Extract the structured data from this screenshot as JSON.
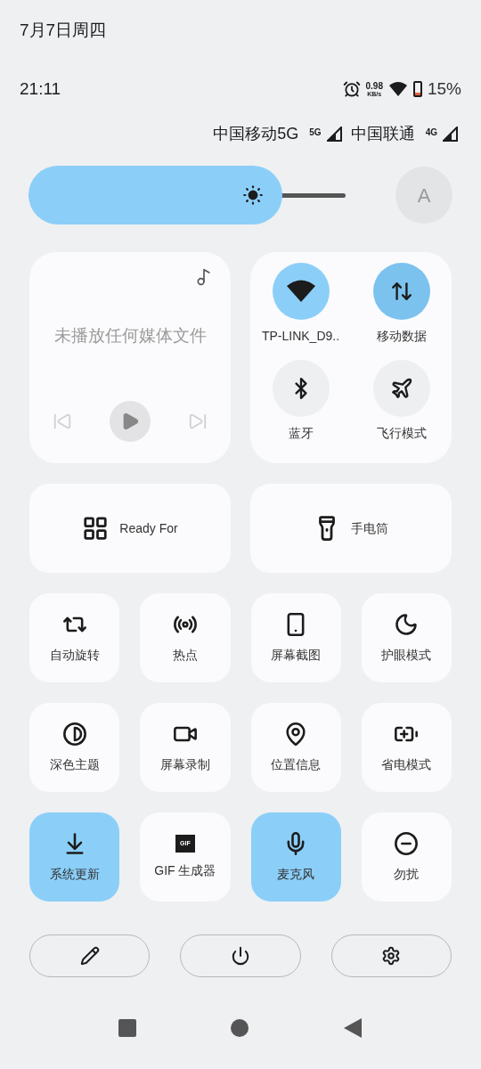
{
  "status_bar": {
    "date": "7月7日周四",
    "time": "21:11",
    "net_speed": "0.98",
    "net_unit": "KB/s",
    "battery": "15%"
  },
  "carriers": [
    {
      "name": "中国移动5G",
      "network": "5G"
    },
    {
      "name": "中国联通",
      "network": "4G"
    }
  ],
  "brightness": {
    "level": 0.8
  },
  "auto_brightness": {
    "label": "A",
    "on": false
  },
  "media": {
    "message": "未播放任何媒体文件",
    "playing": false
  },
  "connectivity": [
    {
      "label": "TP-LINK_D9..",
      "on": true
    },
    {
      "label": "移动数据",
      "on": true
    },
    {
      "label": "蓝牙",
      "on": false
    },
    {
      "label": "飞行模式",
      "on": false
    }
  ],
  "wide_tiles": [
    {
      "label": "Ready For"
    },
    {
      "label": "手电筒"
    }
  ],
  "tiles": [
    {
      "label": "自动旋转",
      "on": false
    },
    {
      "label": "热点",
      "on": false
    },
    {
      "label": "屏幕截图",
      "on": false
    },
    {
      "label": "护眼模式",
      "on": false
    },
    {
      "label": "深色主题",
      "on": false
    },
    {
      "label": "屏幕录制",
      "on": false
    },
    {
      "label": "位置信息",
      "on": false
    },
    {
      "label": "省电模式",
      "on": false
    },
    {
      "label": "系统更新",
      "on": true
    },
    {
      "label": "GIF 生成器",
      "on": false,
      "icon_text": "GIF"
    },
    {
      "label": "麦克风",
      "on": true
    },
    {
      "label": "勿扰",
      "on": false
    }
  ]
}
